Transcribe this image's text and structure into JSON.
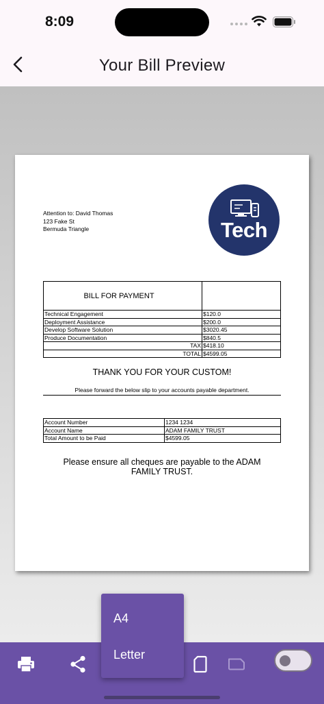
{
  "status_bar": {
    "time": "8:09"
  },
  "header": {
    "title": "Your Bill Preview"
  },
  "bill": {
    "attention_lines": [
      "Attention to: David Thomas",
      "123 Fake St",
      "Bermuda Triangle"
    ],
    "logo_text": "Tech",
    "heading": "BILL FOR PAYMENT",
    "items": [
      {
        "label": "Technical Engagement",
        "amount": "$120.0"
      },
      {
        "label": "Deployment Assistance",
        "amount": "$200.0"
      },
      {
        "label": "Develop Software Solution",
        "amount": "$3020.45"
      },
      {
        "label": "Produce Documentation",
        "amount": "$840.5"
      }
    ],
    "tax_label": "TAX",
    "tax_amount": "$418.10",
    "total_label": "TOTAL",
    "total_amount": "$4599.05",
    "thank_you": "THANK YOU FOR YOUR CUSTOM!",
    "forward_note": "Please forward the below slip to your accounts payable department.",
    "account_rows": [
      {
        "key": "Account Number",
        "value": "1234 1234"
      },
      {
        "key": "Account Name",
        "value": "ADAM FAMILY TRUST"
      },
      {
        "key": "Total Amount to be Paid",
        "value": "$4599.05"
      }
    ],
    "cheque_note_line1": "Please ensure all cheques are payable to the ADAM",
    "cheque_note_line2": "FAMILY TRUST."
  },
  "paper_menu": {
    "options": [
      "A4",
      "Letter"
    ]
  },
  "toolbar": {
    "icons": [
      "print-icon",
      "share-icon",
      "portrait-page-icon",
      "landscape-page-icon"
    ],
    "toggle_on": false
  },
  "colors": {
    "accent": "#6a51a6",
    "logo_bg": "#23346b",
    "header_bg": "#fdf7fb"
  }
}
